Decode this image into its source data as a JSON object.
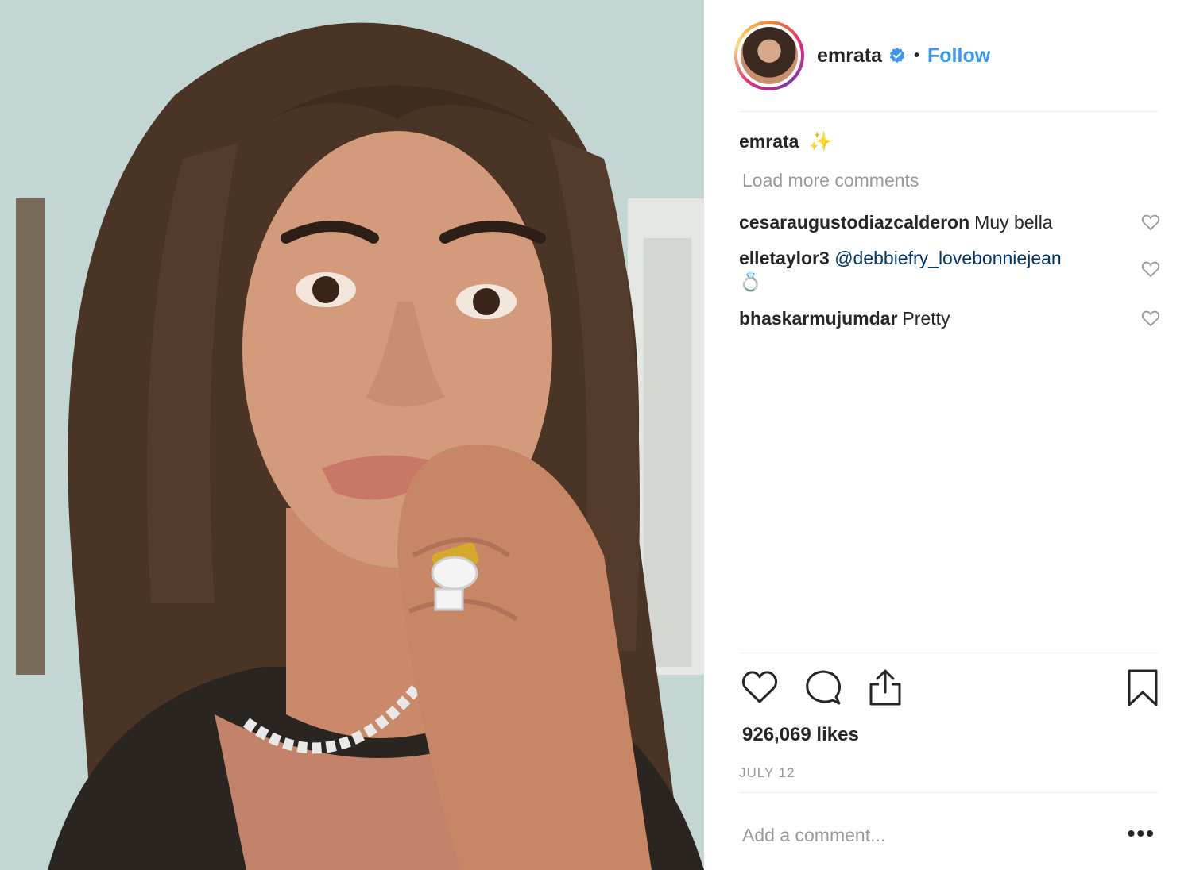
{
  "post": {
    "username": "emrata",
    "follow_label": "Follow",
    "separator": "•",
    "caption_user": "emrata",
    "caption_text": "✨",
    "load_more_label": "Load more comments",
    "comments": [
      {
        "user": "cesaraugustodiazcalderon",
        "text": "Muy bella"
      },
      {
        "user": "elletaylor3",
        "mention": "@debbiefry_lovebonniejean",
        "text": "💍"
      },
      {
        "user": "bhaskarmujumdar",
        "text": "Pretty"
      }
    ],
    "likes_text": "926,069 likes",
    "date_text": "JULY 12",
    "add_comment_placeholder": "Add a comment...",
    "more_label": "•••"
  },
  "colors": {
    "link_blue": "#3897f0",
    "text": "#262626",
    "muted": "#999999",
    "divider": "#efefef"
  },
  "icons": {
    "verified": "verified-badge-icon",
    "like": "heart-icon",
    "comment": "comment-bubble-icon",
    "share": "share-icon",
    "save": "bookmark-icon"
  }
}
